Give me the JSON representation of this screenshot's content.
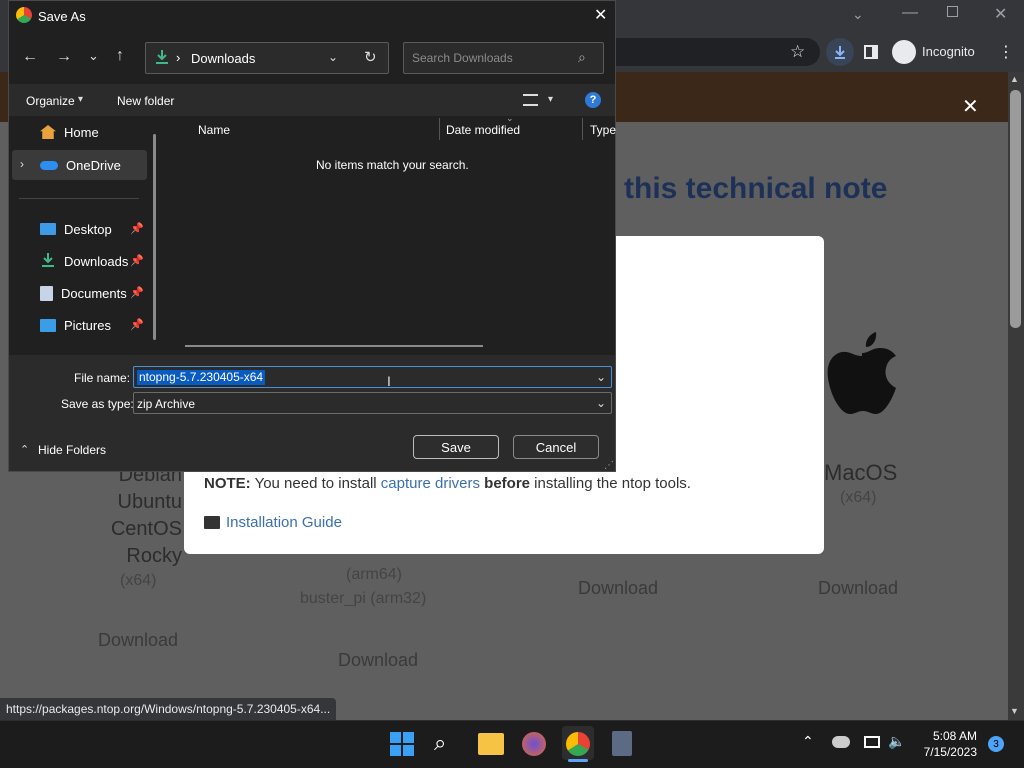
{
  "dialog": {
    "title": "Save As",
    "breadcrumb": "Downloads",
    "search_placeholder": "Search Downloads",
    "organize_label": "Organize",
    "new_folder_label": "New folder",
    "columns": [
      "Name",
      "Date modified",
      "Type"
    ],
    "empty_message": "No items match your search.",
    "sidebar": {
      "items": [
        {
          "label": "Home",
          "icon": "home-icon"
        },
        {
          "label": "OneDrive",
          "icon": "onedrive-icon"
        },
        {
          "label": "Desktop",
          "icon": "desktop-icon",
          "pinned": true
        },
        {
          "label": "Downloads",
          "icon": "downloads-icon",
          "pinned": true
        },
        {
          "label": "Documents",
          "icon": "documents-icon",
          "pinned": true
        },
        {
          "label": "Pictures",
          "icon": "pictures-icon",
          "pinned": true
        }
      ]
    },
    "file_name_label": "File name:",
    "file_name_value": "ntopng-5.7.230405-x64",
    "save_type_label": "Save as type:",
    "save_type_value": "zip Archive",
    "hide_folders_label": "Hide Folders",
    "save_label": "Save",
    "cancel_label": "Cancel"
  },
  "browser": {
    "profile_label": "Incognito",
    "status_url": "https://packages.ntop.org/Windows/ntopng-5.7.230405-x64...",
    "accent": "#8ab4f8"
  },
  "page": {
    "heading_partial": "this technical note",
    "note_prefix": "NOTE:",
    "note_mid1": " You need to install ",
    "note_link": "capture drivers",
    "note_bold2": " before",
    "note_suffix": " installing the ntop tools.",
    "install_link": "Installation Guide",
    "left_os": [
      "Debian",
      "Ubuntu",
      "CentOS",
      "Rocky"
    ],
    "left_arch": "(x64)",
    "mid_arch1": "(arm64)",
    "mid_arch2": "buster_pi (arm32)",
    "macos_label": "MacOS",
    "macos_arch": "(x64)",
    "download_label": "Download"
  },
  "taskbar": {
    "time": "5:08 AM",
    "date": "7/15/2023",
    "notification_count": "3"
  }
}
